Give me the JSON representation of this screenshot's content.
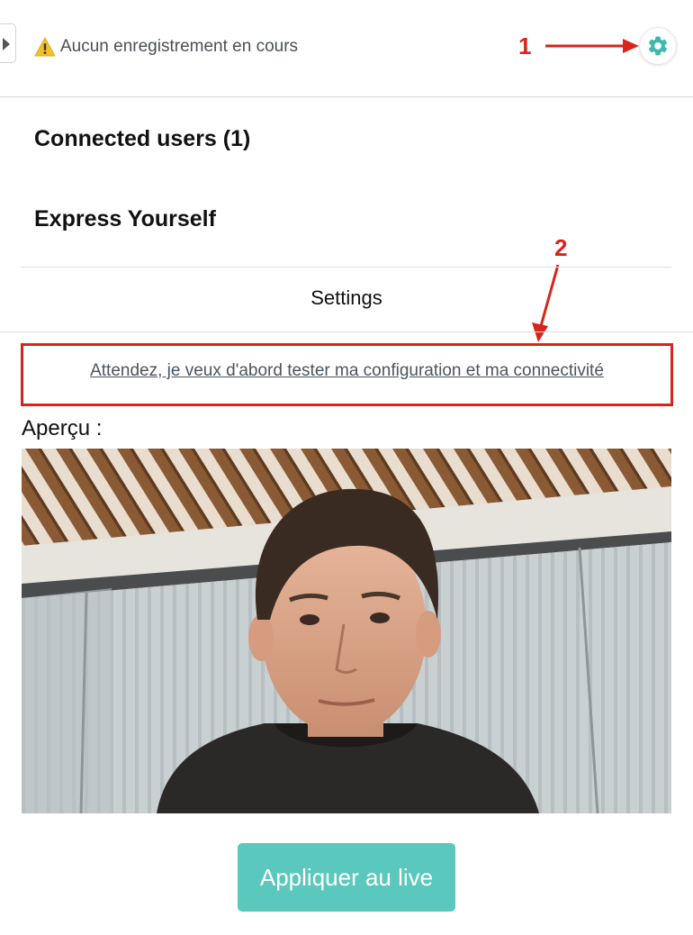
{
  "topbar": {
    "status_text": "Aucun enregistrement en cours",
    "status_icon": "warning-icon",
    "settings_icon": "gear-icon"
  },
  "annotations": {
    "marker_1": "1",
    "marker_2": "2",
    "color": "#d9241c"
  },
  "sections": {
    "connected_users": "Connected users (1)",
    "express_yourself": "Express Yourself",
    "settings": "Settings"
  },
  "settings_panel": {
    "test_link": "Attendez, je veux d'abord tester ma configuration et ma connectivité",
    "preview_label": "Aperçu :",
    "apply_button": "Appliquer au live"
  },
  "colors": {
    "accent": "#5bc8bd",
    "warning": "#f2c028",
    "link": "#4a5560"
  }
}
